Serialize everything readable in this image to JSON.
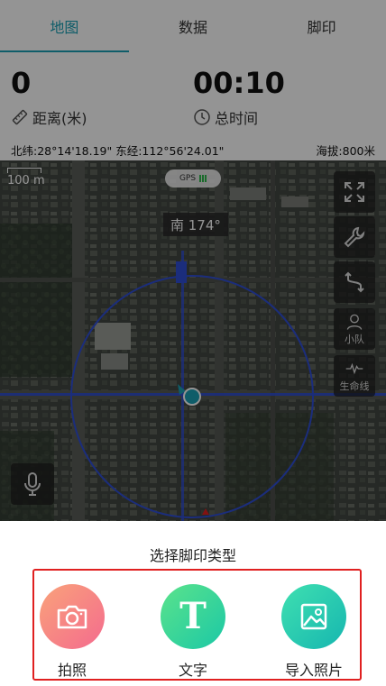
{
  "tabs": [
    {
      "label": "地图",
      "active": true
    },
    {
      "label": "数据",
      "active": false
    },
    {
      "label": "脚印",
      "active": false
    }
  ],
  "stats": {
    "distance": {
      "value": "0",
      "label": "距离(米)",
      "icon": "ruler-icon"
    },
    "time": {
      "value": "00:10",
      "label": "总时间",
      "icon": "clock-icon"
    }
  },
  "coords": {
    "latlon": "北纬:28°14'18.19\" 东经:112°56'24.01\"",
    "altitude": "海拔:800米"
  },
  "map": {
    "scale": "100 m",
    "gps_label": "GPS",
    "heading": "南 174°",
    "buttons": [
      {
        "name": "fullscreen",
        "label": "",
        "icon": "expand-icon"
      },
      {
        "name": "tools",
        "label": "",
        "icon": "wrench-icon"
      },
      {
        "name": "route",
        "label": "",
        "icon": "route-icon"
      },
      {
        "name": "team",
        "label": "小队",
        "icon": "team-icon"
      },
      {
        "name": "lifeline",
        "label": "生命线",
        "icon": "pulse-icon"
      }
    ],
    "colors": {
      "ring": "#2f4fd6",
      "marker": "#1aa0b5",
      "accent": "#1aa0b5"
    }
  },
  "sheet": {
    "title": "选择脚印类型",
    "options": [
      {
        "label": "拍照",
        "icon": "camera-icon"
      },
      {
        "label": "文字",
        "icon": "text-icon",
        "glyph": "T"
      },
      {
        "label": "导入照片",
        "icon": "image-icon"
      }
    ],
    "highlight_color": "#e02020"
  }
}
